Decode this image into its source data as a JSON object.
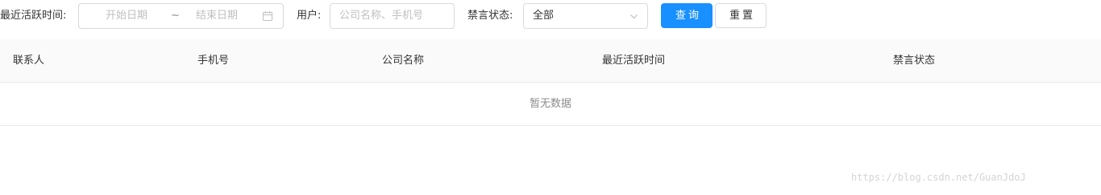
{
  "filters": {
    "active_time_label": "最近活跃时间:",
    "start_date_placeholder": "开始日期",
    "range_separator": "~",
    "end_date_placeholder": "结束日期",
    "user_label": "用户:",
    "user_placeholder": "公司名称、手机号",
    "mute_status_label": "禁言状态:",
    "mute_status_value": "全部"
  },
  "buttons": {
    "search": "查询",
    "reset": "重置"
  },
  "table": {
    "columns": [
      "联系人",
      "手机号",
      "公司名称",
      "最近活跃时间",
      "禁言状态"
    ],
    "empty_text": "暂无数据"
  },
  "watermark": "https://blog.csdn.net/GuanJdoJ",
  "colors": {
    "primary": "#1890ff",
    "border": "#d9d9d9",
    "header_bg": "#fafafa",
    "placeholder": "#bfbfbf"
  },
  "icons": {
    "date_picker": "calendar-icon",
    "select": "chevron-down-icon"
  }
}
